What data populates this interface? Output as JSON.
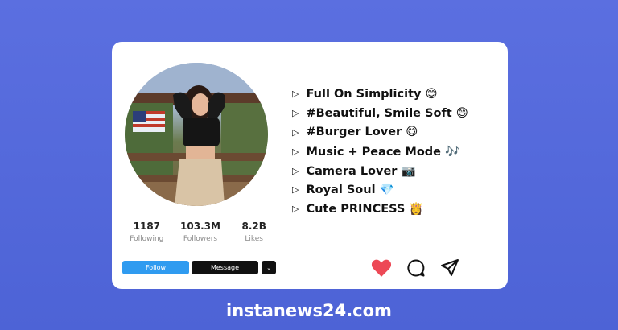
{
  "profile": {
    "avatar_icon": "profile-photo",
    "stats": [
      {
        "value": "1187",
        "label": "Following"
      },
      {
        "value": "103.3M",
        "label": "Followers"
      },
      {
        "value": "8.2B",
        "label": "Likes"
      }
    ],
    "buttons": {
      "follow": "Follow",
      "message": "Message",
      "more": "⌄"
    }
  },
  "bio": [
    "Full On Simplicity 😊",
    "#Beautiful, Smile Soft 😄",
    "#Burger Lover 😋",
    "Music + Peace Mode 🎶",
    "Camera Lover 📷",
    "Royal Soul 💎",
    "Cute PRINCESS 👸"
  ],
  "bio_bullet": "▷",
  "actions": {
    "like_icon": "heart-icon",
    "comment_icon": "comment-icon",
    "share_icon": "send-icon",
    "like_color": "#ed4956"
  },
  "footer": {
    "site": "instanews24.com"
  }
}
